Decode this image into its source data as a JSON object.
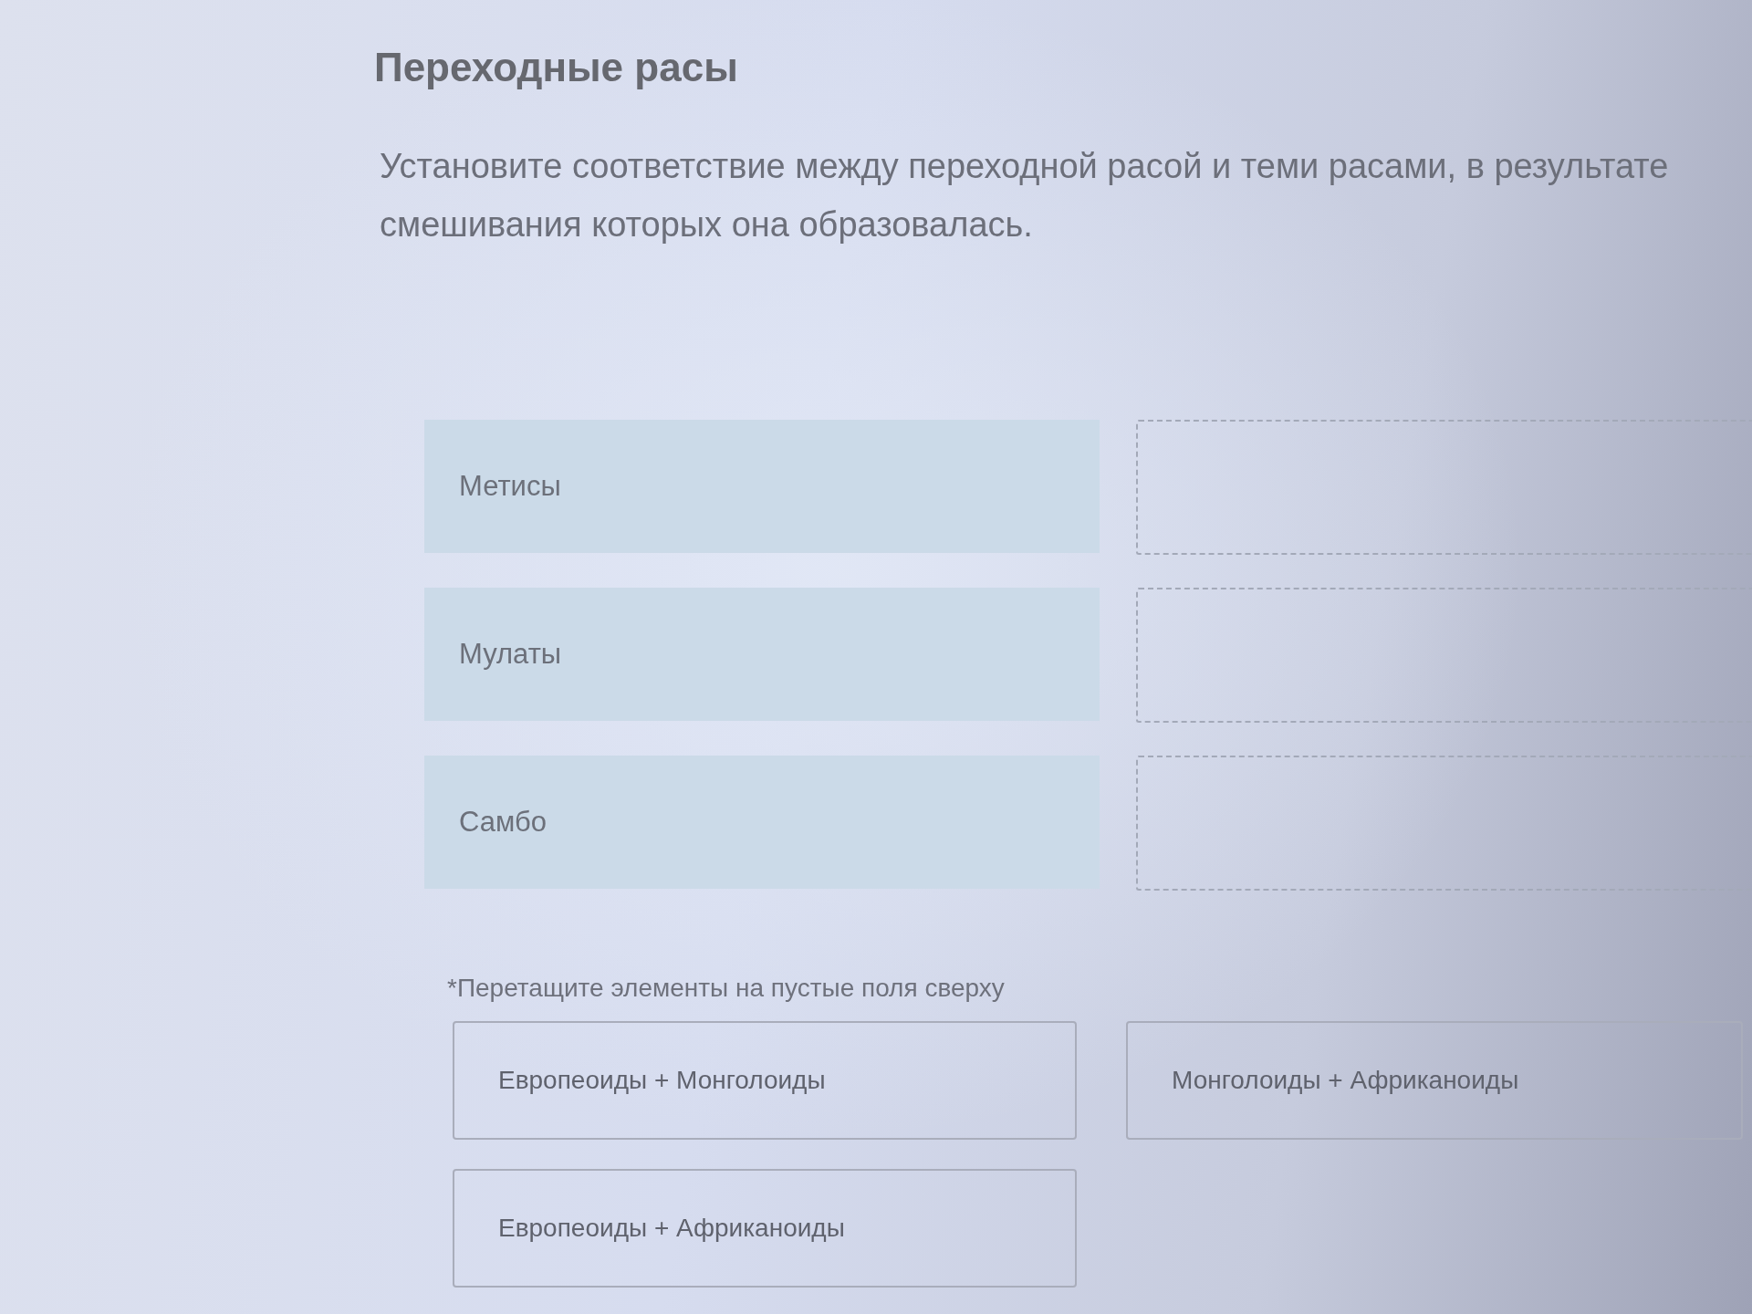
{
  "title": "Переходные расы",
  "instruction": "Установите соответствие между переходной расой и теми расами, в результате смешивания которых она образовалась.",
  "pairs": [
    {
      "label": "Метисы"
    },
    {
      "label": "Мулаты"
    },
    {
      "label": "Самбо"
    }
  ],
  "hint": "*Перетащите элементы на пустые поля сверху",
  "options": [
    "Европеоиды + Монголоиды",
    "Монголоиды + Африканоиды",
    "Европеоиды + Африканоиды"
  ]
}
